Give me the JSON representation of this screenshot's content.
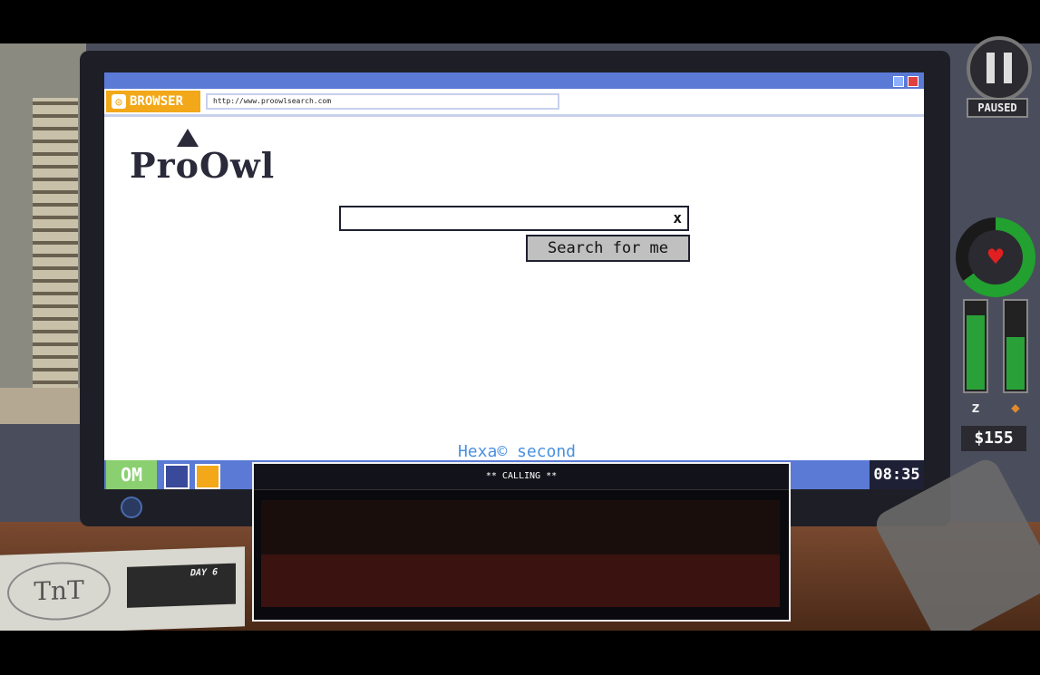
{
  "browser": {
    "app_label": "BROWSER",
    "app_icon": "browser-icon",
    "url": "http://www.proowlsearch.com",
    "logo_text": "ProOwl",
    "search_value": "",
    "search_clear": "x",
    "search_button": "Search for me",
    "result_link": "Hexa© second angle"
  },
  "taskbar": {
    "start_label": "OM",
    "clock": "08:35"
  },
  "call": {
    "header": "** CALLING **"
  },
  "hud": {
    "paused_label": "PAUSED",
    "money": "$155",
    "health_fraction": 0.65,
    "sleep_fraction": 0.85,
    "food_fraction": 0.6,
    "sleep_icon": "zzz-icon",
    "food_icon": "drumstick-icon"
  },
  "newspaper": {
    "day_label": "DAY 6"
  },
  "colors": {
    "titlebar": "#5a7ad6",
    "accent": "#f2a818",
    "link": "#4a90e0",
    "health": "#22a030"
  }
}
